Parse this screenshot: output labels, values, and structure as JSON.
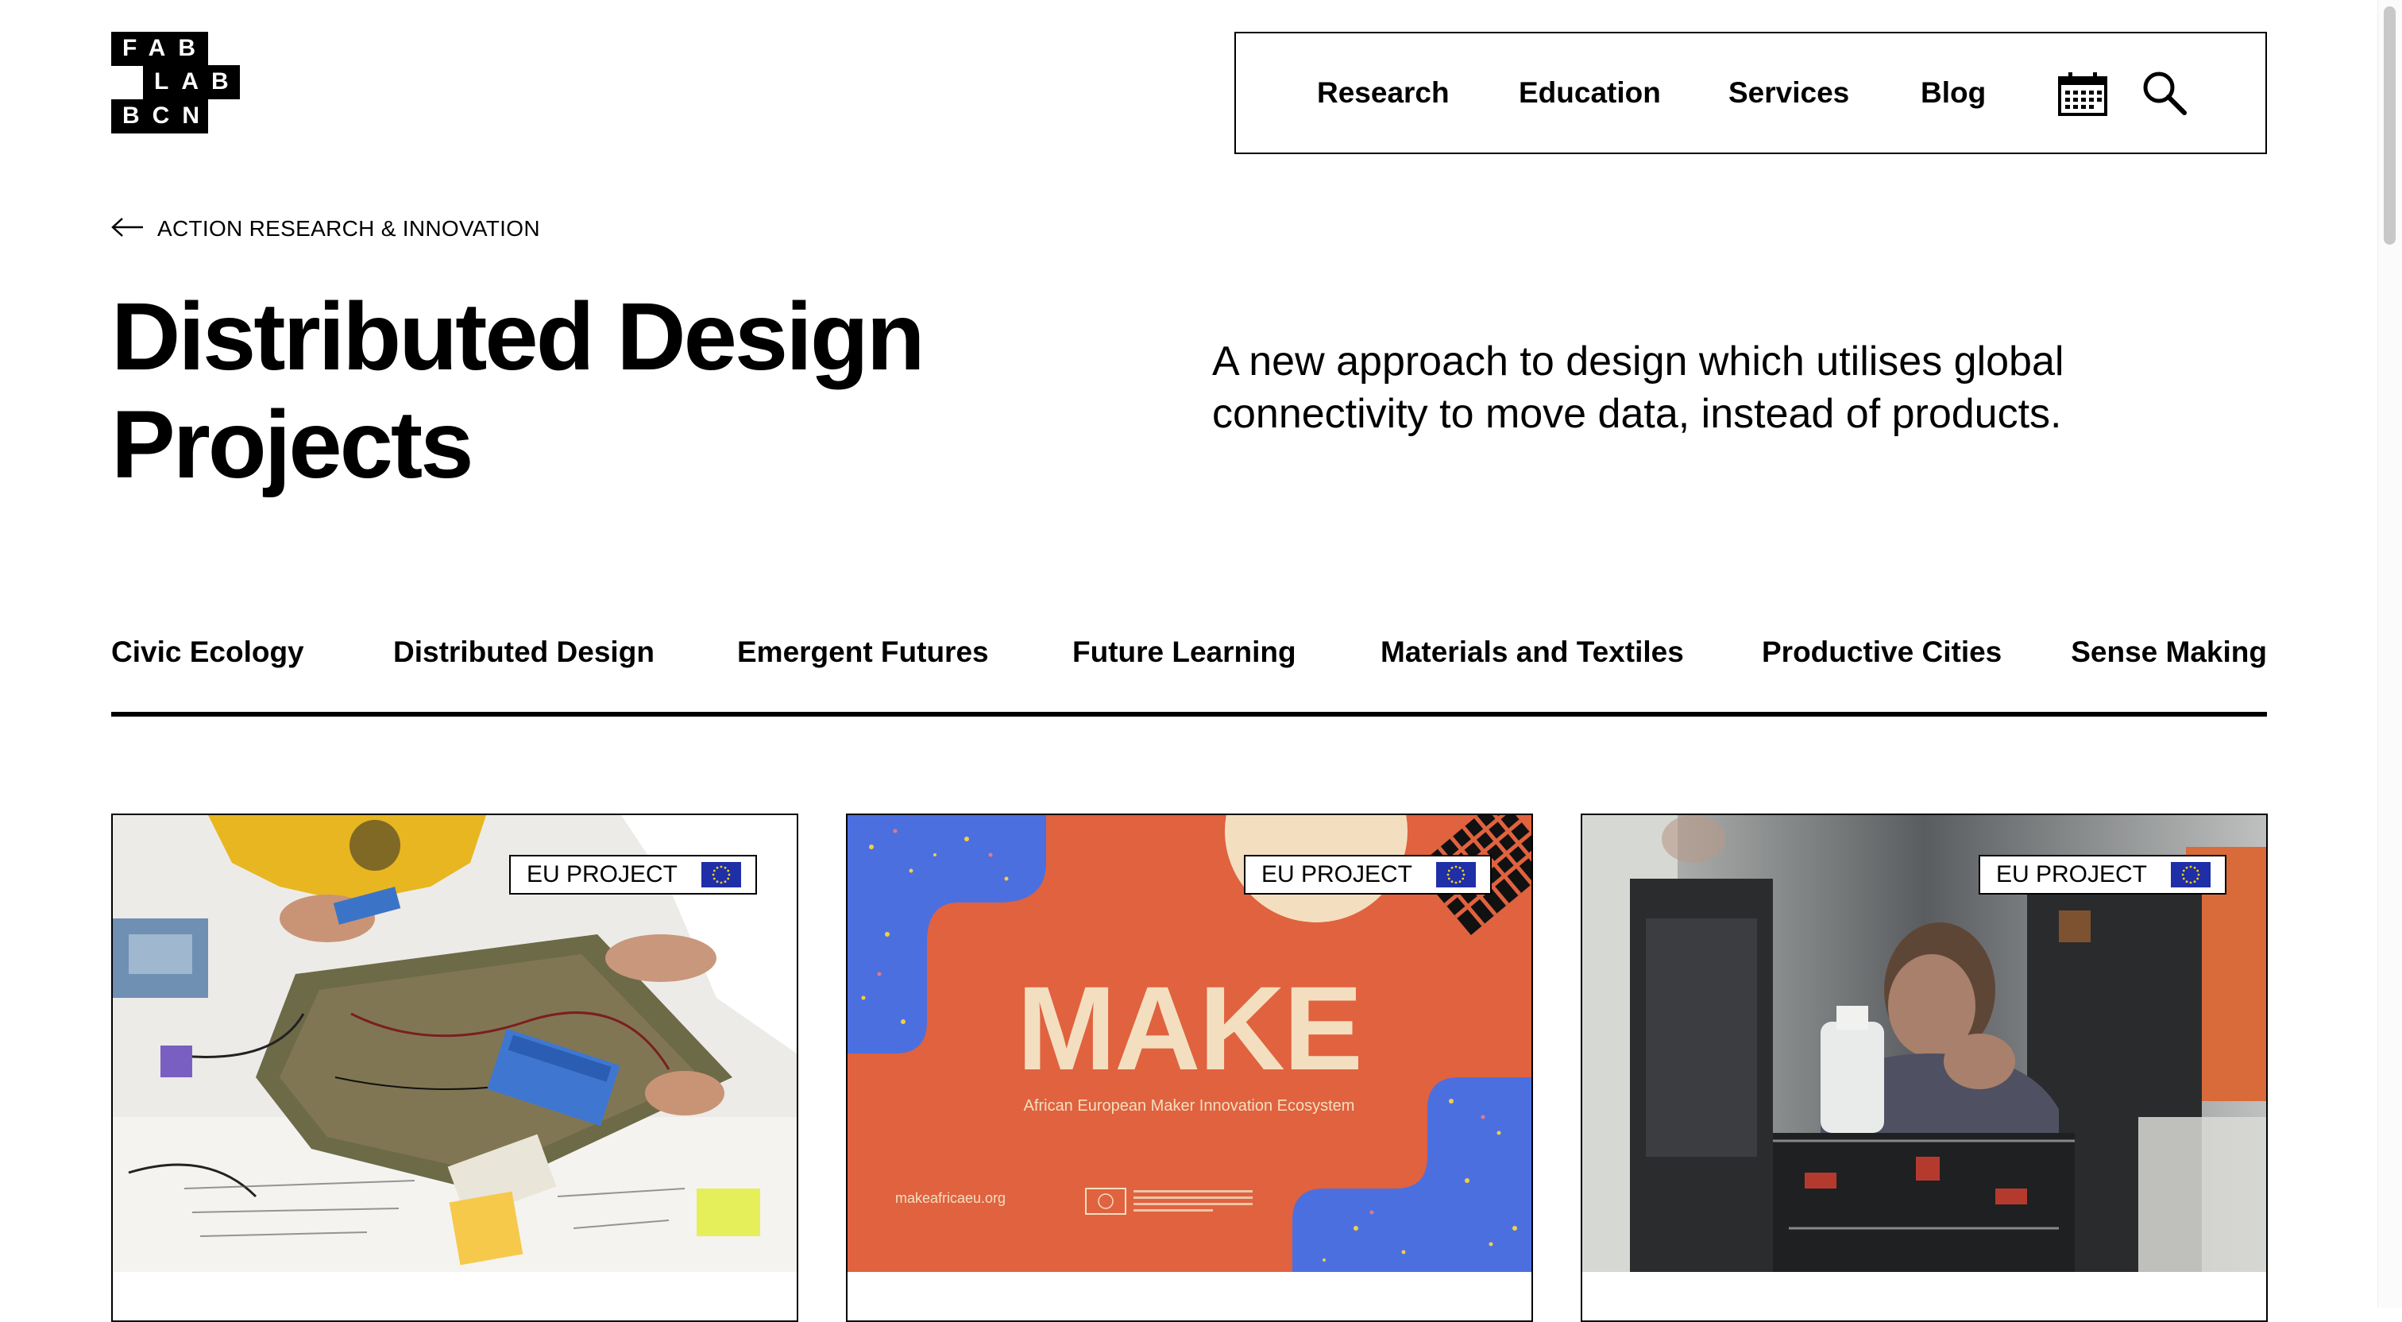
{
  "logo": {
    "lines": [
      "FAB",
      "LAB",
      "BCN"
    ]
  },
  "nav": {
    "links": [
      "Research",
      "Education",
      "Services",
      "Blog"
    ],
    "icons": [
      "calendar-icon",
      "search-icon"
    ]
  },
  "breadcrumb": {
    "label": "ACTION RESEARCH & INNOVATION",
    "icon": "arrow-left-icon"
  },
  "page": {
    "title_line1": "Distributed Design",
    "title_line2": "Projects",
    "intro": "A new approach to design which utilises global connectivity to move data, instead of products."
  },
  "categories": [
    "Civic Ecology",
    "Distributed Design",
    "Emergent Futures",
    "Future Learning",
    "Materials and Textiles",
    "Productive Cities",
    "Sense Making"
  ],
  "cards": [
    {
      "badge": "EU PROJECT",
      "image": "workshop-electronics-photo"
    },
    {
      "badge": "EU PROJECT",
      "image": "make-poster",
      "poster_title": "MAKE",
      "poster_subtitle": "African European Maker Innovation Ecosystem",
      "poster_url": "makeafricaeu.org"
    },
    {
      "badge": "EU PROJECT",
      "image": "lab-machine-photo"
    }
  ],
  "colors": {
    "accent": "#000000",
    "eu_blue": "#1f2fa8",
    "eu_star": "#f7d117",
    "poster_orange": "#e0623f",
    "poster_blue": "#4c6fe0",
    "poster_cream": "#f3dfc0"
  }
}
